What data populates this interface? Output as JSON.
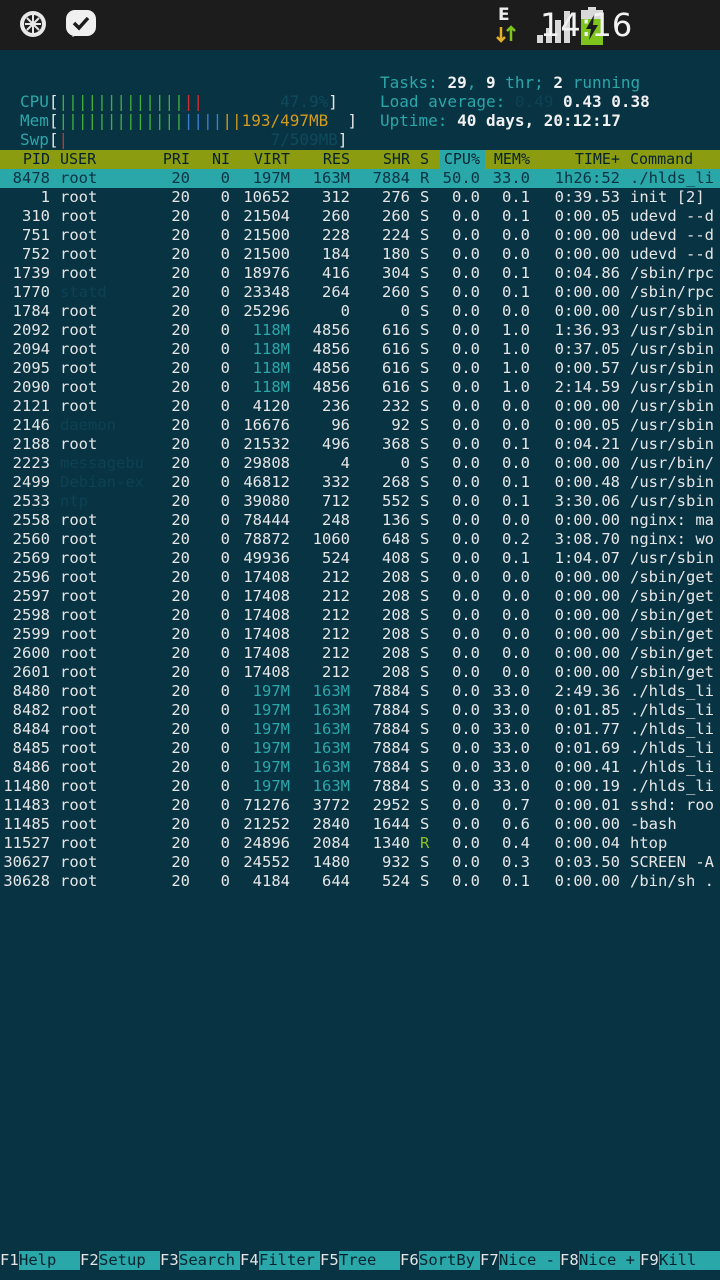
{
  "statusbar": {
    "time": "14:16",
    "network_label": "E",
    "icons": [
      "mobile-app-icon",
      "blackberry-messenger-icon",
      "data-transfer-icon",
      "signal-icon",
      "battery-charging-icon"
    ]
  },
  "meters": {
    "cpu": {
      "label": "CPU",
      "value": "47.9%",
      "percent": 47.9
    },
    "mem": {
      "label": "Mem",
      "value": "193/497MB",
      "used": 193,
      "total": 497
    },
    "swp": {
      "label": "Swp",
      "value": "7/509MB",
      "used": 7,
      "total": 509
    }
  },
  "info": {
    "tasks_label": "Tasks:",
    "tasks": "29",
    "thr": "9",
    "thr_label": "thr;",
    "running": "2",
    "running_label": "running",
    "load_label": "Load average:",
    "load1": "0.49",
    "load5": "0.43",
    "load15": "0.38",
    "uptime_label": "Uptime:",
    "uptime": "40 days, 20:12:17"
  },
  "columns": [
    "PID",
    "USER",
    "PRI",
    "NI",
    "VIRT",
    "RES",
    "SHR",
    "S",
    "CPU%",
    "MEM%",
    "TIME+",
    "Command"
  ],
  "processes": [
    {
      "pid": "8478",
      "user": "root",
      "pri": "20",
      "ni": "0",
      "virt": "197M",
      "res": "163M",
      "shr": "7884",
      "s": "R",
      "cpu": "50.0",
      "mem": "33.0",
      "time": "1h26:52",
      "cmd": "./hlds_li"
    },
    {
      "pid": "1",
      "user": "root",
      "pri": "20",
      "ni": "0",
      "virt": "10652",
      "res": "312",
      "shr": "276",
      "s": "S",
      "cpu": "0.0",
      "mem": "0.1",
      "time": "0:39.53",
      "cmd": "init [2]"
    },
    {
      "pid": "310",
      "user": "root",
      "pri": "20",
      "ni": "0",
      "virt": "21504",
      "res": "260",
      "shr": "260",
      "s": "S",
      "cpu": "0.0",
      "mem": "0.1",
      "time": "0:00.05",
      "cmd": "udevd --d"
    },
    {
      "pid": "751",
      "user": "root",
      "pri": "20",
      "ni": "0",
      "virt": "21500",
      "res": "228",
      "shr": "224",
      "s": "S",
      "cpu": "0.0",
      "mem": "0.0",
      "time": "0:00.00",
      "cmd": "udevd --d"
    },
    {
      "pid": "752",
      "user": "root",
      "pri": "20",
      "ni": "0",
      "virt": "21500",
      "res": "184",
      "shr": "180",
      "s": "S",
      "cpu": "0.0",
      "mem": "0.0",
      "time": "0:00.00",
      "cmd": "udevd --d"
    },
    {
      "pid": "1739",
      "user": "root",
      "pri": "20",
      "ni": "0",
      "virt": "18976",
      "res": "416",
      "shr": "304",
      "s": "S",
      "cpu": "0.0",
      "mem": "0.1",
      "time": "0:04.86",
      "cmd": "/sbin/rpc"
    },
    {
      "pid": "1770",
      "user": "statd",
      "pri": "20",
      "ni": "0",
      "virt": "23348",
      "res": "264",
      "shr": "260",
      "s": "S",
      "cpu": "0.0",
      "mem": "0.1",
      "time": "0:00.00",
      "cmd": "/sbin/rpc"
    },
    {
      "pid": "1784",
      "user": "root",
      "pri": "20",
      "ni": "0",
      "virt": "25296",
      "res": "0",
      "shr": "0",
      "s": "S",
      "cpu": "0.0",
      "mem": "0.0",
      "time": "0:00.00",
      "cmd": "/usr/sbin"
    },
    {
      "pid": "2092",
      "user": "root",
      "pri": "20",
      "ni": "0",
      "virt": "118M",
      "res": "4856",
      "shr": "616",
      "s": "S",
      "cpu": "0.0",
      "mem": "1.0",
      "time": "1:36.93",
      "cmd": "/usr/sbin"
    },
    {
      "pid": "2094",
      "user": "root",
      "pri": "20",
      "ni": "0",
      "virt": "118M",
      "res": "4856",
      "shr": "616",
      "s": "S",
      "cpu": "0.0",
      "mem": "1.0",
      "time": "0:37.05",
      "cmd": "/usr/sbin"
    },
    {
      "pid": "2095",
      "user": "root",
      "pri": "20",
      "ni": "0",
      "virt": "118M",
      "res": "4856",
      "shr": "616",
      "s": "S",
      "cpu": "0.0",
      "mem": "1.0",
      "time": "0:00.57",
      "cmd": "/usr/sbin"
    },
    {
      "pid": "2090",
      "user": "root",
      "pri": "20",
      "ni": "0",
      "virt": "118M",
      "res": "4856",
      "shr": "616",
      "s": "S",
      "cpu": "0.0",
      "mem": "1.0",
      "time": "2:14.59",
      "cmd": "/usr/sbin"
    },
    {
      "pid": "2121",
      "user": "root",
      "pri": "20",
      "ni": "0",
      "virt": "4120",
      "res": "236",
      "shr": "232",
      "s": "S",
      "cpu": "0.0",
      "mem": "0.0",
      "time": "0:00.00",
      "cmd": "/usr/sbin"
    },
    {
      "pid": "2146",
      "user": "daemon",
      "pri": "20",
      "ni": "0",
      "virt": "16676",
      "res": "96",
      "shr": "92",
      "s": "S",
      "cpu": "0.0",
      "mem": "0.0",
      "time": "0:00.05",
      "cmd": "/usr/sbin"
    },
    {
      "pid": "2188",
      "user": "root",
      "pri": "20",
      "ni": "0",
      "virt": "21532",
      "res": "496",
      "shr": "368",
      "s": "S",
      "cpu": "0.0",
      "mem": "0.1",
      "time": "0:04.21",
      "cmd": "/usr/sbin"
    },
    {
      "pid": "2223",
      "user": "messagebu",
      "pri": "20",
      "ni": "0",
      "virt": "29808",
      "res": "4",
      "shr": "0",
      "s": "S",
      "cpu": "0.0",
      "mem": "0.0",
      "time": "0:00.00",
      "cmd": "/usr/bin/"
    },
    {
      "pid": "2499",
      "user": "Debian-ex",
      "pri": "20",
      "ni": "0",
      "virt": "46812",
      "res": "332",
      "shr": "268",
      "s": "S",
      "cpu": "0.0",
      "mem": "0.1",
      "time": "0:00.48",
      "cmd": "/usr/sbin"
    },
    {
      "pid": "2533",
      "user": "ntp",
      "pri": "20",
      "ni": "0",
      "virt": "39080",
      "res": "712",
      "shr": "552",
      "s": "S",
      "cpu": "0.0",
      "mem": "0.1",
      "time": "3:30.06",
      "cmd": "/usr/sbin"
    },
    {
      "pid": "2558",
      "user": "root",
      "pri": "20",
      "ni": "0",
      "virt": "78444",
      "res": "248",
      "shr": "136",
      "s": "S",
      "cpu": "0.0",
      "mem": "0.0",
      "time": "0:00.00",
      "cmd": "nginx: ma"
    },
    {
      "pid": "2560",
      "user": "root",
      "pri": "20",
      "ni": "0",
      "virt": "78872",
      "res": "1060",
      "shr": "648",
      "s": "S",
      "cpu": "0.0",
      "mem": "0.2",
      "time": "3:08.70",
      "cmd": "nginx: wo"
    },
    {
      "pid": "2569",
      "user": "root",
      "pri": "20",
      "ni": "0",
      "virt": "49936",
      "res": "524",
      "shr": "408",
      "s": "S",
      "cpu": "0.0",
      "mem": "0.1",
      "time": "1:04.07",
      "cmd": "/usr/sbin"
    },
    {
      "pid": "2596",
      "user": "root",
      "pri": "20",
      "ni": "0",
      "virt": "17408",
      "res": "212",
      "shr": "208",
      "s": "S",
      "cpu": "0.0",
      "mem": "0.0",
      "time": "0:00.00",
      "cmd": "/sbin/get"
    },
    {
      "pid": "2597",
      "user": "root",
      "pri": "20",
      "ni": "0",
      "virt": "17408",
      "res": "212",
      "shr": "208",
      "s": "S",
      "cpu": "0.0",
      "mem": "0.0",
      "time": "0:00.00",
      "cmd": "/sbin/get"
    },
    {
      "pid": "2598",
      "user": "root",
      "pri": "20",
      "ni": "0",
      "virt": "17408",
      "res": "212",
      "shr": "208",
      "s": "S",
      "cpu": "0.0",
      "mem": "0.0",
      "time": "0:00.00",
      "cmd": "/sbin/get"
    },
    {
      "pid": "2599",
      "user": "root",
      "pri": "20",
      "ni": "0",
      "virt": "17408",
      "res": "212",
      "shr": "208",
      "s": "S",
      "cpu": "0.0",
      "mem": "0.0",
      "time": "0:00.00",
      "cmd": "/sbin/get"
    },
    {
      "pid": "2600",
      "user": "root",
      "pri": "20",
      "ni": "0",
      "virt": "17408",
      "res": "212",
      "shr": "208",
      "s": "S",
      "cpu": "0.0",
      "mem": "0.0",
      "time": "0:00.00",
      "cmd": "/sbin/get"
    },
    {
      "pid": "2601",
      "user": "root",
      "pri": "20",
      "ni": "0",
      "virt": "17408",
      "res": "212",
      "shr": "208",
      "s": "S",
      "cpu": "0.0",
      "mem": "0.0",
      "time": "0:00.00",
      "cmd": "/sbin/get"
    },
    {
      "pid": "8480",
      "user": "root",
      "pri": "20",
      "ni": "0",
      "virt": "197M",
      "res": "163M",
      "shr": "7884",
      "s": "S",
      "cpu": "0.0",
      "mem": "33.0",
      "time": "2:49.36",
      "cmd": "./hlds_li"
    },
    {
      "pid": "8482",
      "user": "root",
      "pri": "20",
      "ni": "0",
      "virt": "197M",
      "res": "163M",
      "shr": "7884",
      "s": "S",
      "cpu": "0.0",
      "mem": "33.0",
      "time": "0:01.85",
      "cmd": "./hlds_li"
    },
    {
      "pid": "8484",
      "user": "root",
      "pri": "20",
      "ni": "0",
      "virt": "197M",
      "res": "163M",
      "shr": "7884",
      "s": "S",
      "cpu": "0.0",
      "mem": "33.0",
      "time": "0:01.77",
      "cmd": "./hlds_li"
    },
    {
      "pid": "8485",
      "user": "root",
      "pri": "20",
      "ni": "0",
      "virt": "197M",
      "res": "163M",
      "shr": "7884",
      "s": "S",
      "cpu": "0.0",
      "mem": "33.0",
      "time": "0:01.69",
      "cmd": "./hlds_li"
    },
    {
      "pid": "8486",
      "user": "root",
      "pri": "20",
      "ni": "0",
      "virt": "197M",
      "res": "163M",
      "shr": "7884",
      "s": "S",
      "cpu": "0.0",
      "mem": "33.0",
      "time": "0:00.41",
      "cmd": "./hlds_li"
    },
    {
      "pid": "11480",
      "user": "root",
      "pri": "20",
      "ni": "0",
      "virt": "197M",
      "res": "163M",
      "shr": "7884",
      "s": "S",
      "cpu": "0.0",
      "mem": "33.0",
      "time": "0:00.19",
      "cmd": "./hlds_li"
    },
    {
      "pid": "11483",
      "user": "root",
      "pri": "20",
      "ni": "0",
      "virt": "71276",
      "res": "3772",
      "shr": "2952",
      "s": "S",
      "cpu": "0.0",
      "mem": "0.7",
      "time": "0:00.01",
      "cmd": "sshd: roo"
    },
    {
      "pid": "11485",
      "user": "root",
      "pri": "20",
      "ni": "0",
      "virt": "21252",
      "res": "2840",
      "shr": "1644",
      "s": "S",
      "cpu": "0.0",
      "mem": "0.6",
      "time": "0:00.00",
      "cmd": "-bash"
    },
    {
      "pid": "11527",
      "user": "root",
      "pri": "20",
      "ni": "0",
      "virt": "24896",
      "res": "2084",
      "shr": "1340",
      "s": "R",
      "cpu": "0.0",
      "mem": "0.4",
      "time": "0:00.04",
      "cmd": "htop"
    },
    {
      "pid": "30627",
      "user": "root",
      "pri": "20",
      "ni": "0",
      "virt": "24552",
      "res": "1480",
      "shr": "932",
      "s": "S",
      "cpu": "0.0",
      "mem": "0.3",
      "time": "0:03.50",
      "cmd": "SCREEN -A"
    },
    {
      "pid": "30628",
      "user": "root",
      "pri": "20",
      "ni": "0",
      "virt": "4184",
      "res": "644",
      "shr": "524",
      "s": "S",
      "cpu": "0.0",
      "mem": "0.1",
      "time": "0:00.00",
      "cmd": "/bin/sh ."
    }
  ],
  "selected_index": 0,
  "function_keys": [
    {
      "key": "F1",
      "label": "Help"
    },
    {
      "key": "F2",
      "label": "Setup"
    },
    {
      "key": "F3",
      "label": "Search"
    },
    {
      "key": "F4",
      "label": "Filter"
    },
    {
      "key": "F5",
      "label": "Tree"
    },
    {
      "key": "F6",
      "label": "SortBy"
    },
    {
      "key": "F7",
      "label": "Nice -"
    },
    {
      "key": "F8",
      "label": "Nice +"
    },
    {
      "key": "F9",
      "label": "Kill"
    }
  ],
  "colors": {
    "background": "#083343",
    "accent": "#2aa7a9",
    "header": "#8c9c10",
    "bar_green": "#3fae3f",
    "bar_red": "#d0312d",
    "bar_orange": "#d49a1c",
    "bar_blue": "#3a7fd3"
  }
}
